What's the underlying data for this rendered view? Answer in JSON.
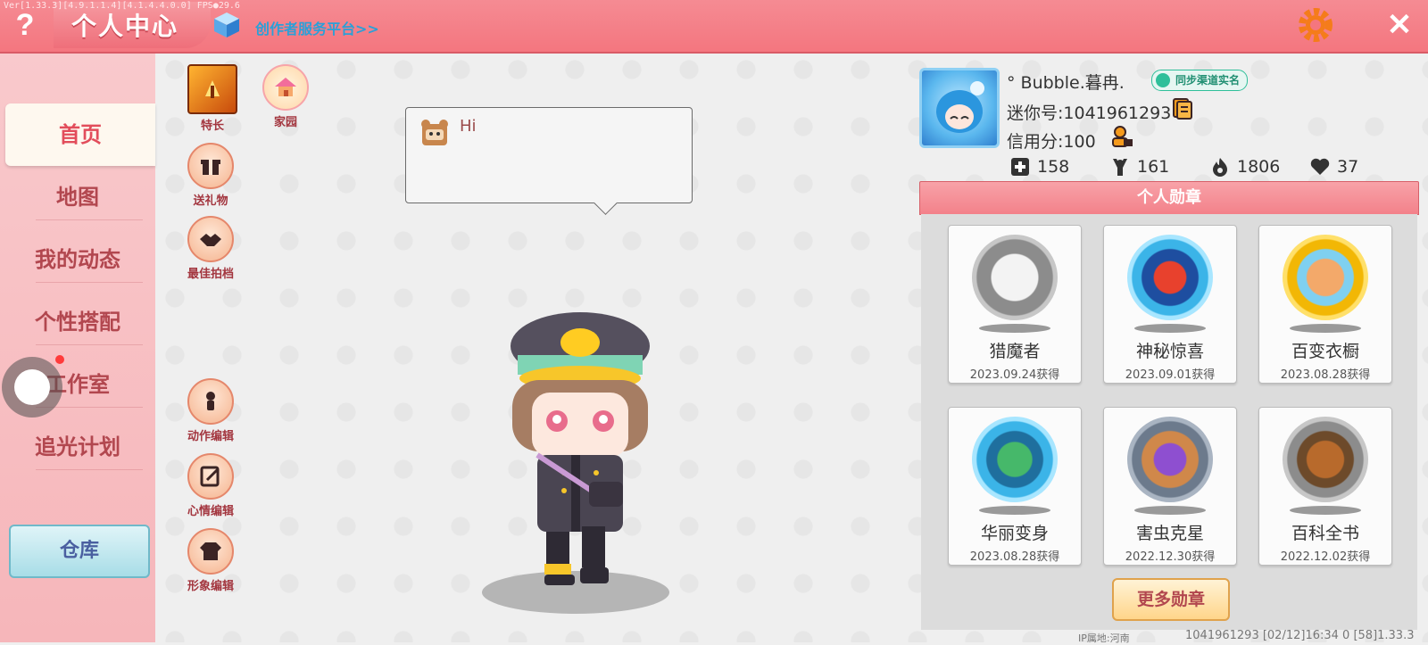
{
  "topbar": {
    "version": "Ver[1.33.3][4.9.1.1.4][4.1.4.4.0.0] FPS●29.6",
    "title": "个人中心",
    "creator_link": "创作者服务平台>>",
    "help_glyph": "?",
    "close_glyph": "✕",
    "accent": "#f4767f"
  },
  "sidebar": {
    "items": [
      {
        "label": "首页",
        "active": true
      },
      {
        "label": "地图"
      },
      {
        "label": "我的动态"
      },
      {
        "label": "个性搭配"
      },
      {
        "label": "工作室"
      },
      {
        "label": "追光计划"
      }
    ],
    "warehouse": "仓库"
  },
  "actions": {
    "special": "特长",
    "home": "家园",
    "gift": "送礼物",
    "partner": "最佳拍档",
    "motion": "动作编辑",
    "mood": "心情编辑",
    "look": "形象编辑"
  },
  "bubble": {
    "text": "Hi"
  },
  "profile": {
    "name": "° Bubble.暮冉.",
    "verify": "同步渠道实名",
    "mini_id": "迷你号:1041961293",
    "credit": "信用分:100",
    "stats": {
      "follow": "158",
      "fans": "161",
      "heat": "1806",
      "likes": "37"
    }
  },
  "badges": {
    "header": "个人勋章",
    "items": [
      {
        "name": "猎魔者",
        "date": "2023.09.24获得",
        "color": "#8c8c8c"
      },
      {
        "name": "神秘惊喜",
        "date": "2023.09.01获得",
        "color": "#3bb4e8"
      },
      {
        "name": "百变衣橱",
        "date": "2023.08.28获得",
        "color": "#f2b705"
      },
      {
        "name": "华丽变身",
        "date": "2023.08.28获得",
        "color": "#3bb4e8"
      },
      {
        "name": "害虫克星",
        "date": "2022.12.30获得",
        "color": "#6c7a8c"
      },
      {
        "name": "百科全书",
        "date": "2022.12.02获得",
        "color": "#8c8c8c"
      }
    ],
    "more": "更多勋章"
  },
  "footer": {
    "ip": "IP属地:河南",
    "info": "1041961293    [02/12]16:34 0  [58]1.33.3"
  }
}
